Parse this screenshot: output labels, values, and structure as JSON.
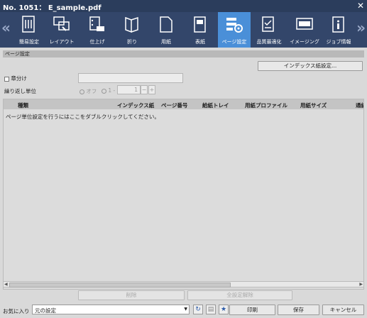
{
  "window": {
    "title": "No. 1051： E_sample.pdf"
  },
  "toolbar": {
    "items": [
      {
        "label": "簡易設定",
        "icon": "quick-settings-icon"
      },
      {
        "label": "レイアウト",
        "icon": "layout-icon"
      },
      {
        "label": "仕上げ",
        "icon": "finishing-icon"
      },
      {
        "label": "折り",
        "icon": "fold-icon"
      },
      {
        "label": "用紙",
        "icon": "paper-icon"
      },
      {
        "label": "表紙",
        "icon": "cover-icon"
      },
      {
        "label": "ページ設定",
        "icon": "page-setting-icon",
        "active": true
      },
      {
        "label": "品質最適化",
        "icon": "quality-icon"
      },
      {
        "label": "イメージング",
        "icon": "imaging-icon"
      },
      {
        "label": "ジョブ情報",
        "icon": "job-info-icon"
      }
    ],
    "active_color": "#4a8fd8"
  },
  "page": {
    "section_title": "ページ設定",
    "index_button": "インデックス紙設定...",
    "chapter_label": "章分け",
    "repeat_label": "繰り返し単位",
    "radio_off": "オフ",
    "radio_one": "1 -",
    "stepper_value": "1",
    "stepper_minus": "−",
    "stepper_plus": "+"
  },
  "table": {
    "columns": [
      "種類",
      "インデックス紙",
      "ページ番号",
      "給紙トレイ",
      "用紙プロファイル",
      "用紙サイズ",
      "通紙"
    ],
    "hint": "ページ単位設定を行うにはここをダブルクリックしてください。"
  },
  "actions": {
    "delete": "削除",
    "delete_all": "全設定解除"
  },
  "footer": {
    "favorites_label": "お気に入り",
    "favorites_value": "元の設定",
    "print": "印刷",
    "save": "保存",
    "cancel": "キャンセル"
  }
}
